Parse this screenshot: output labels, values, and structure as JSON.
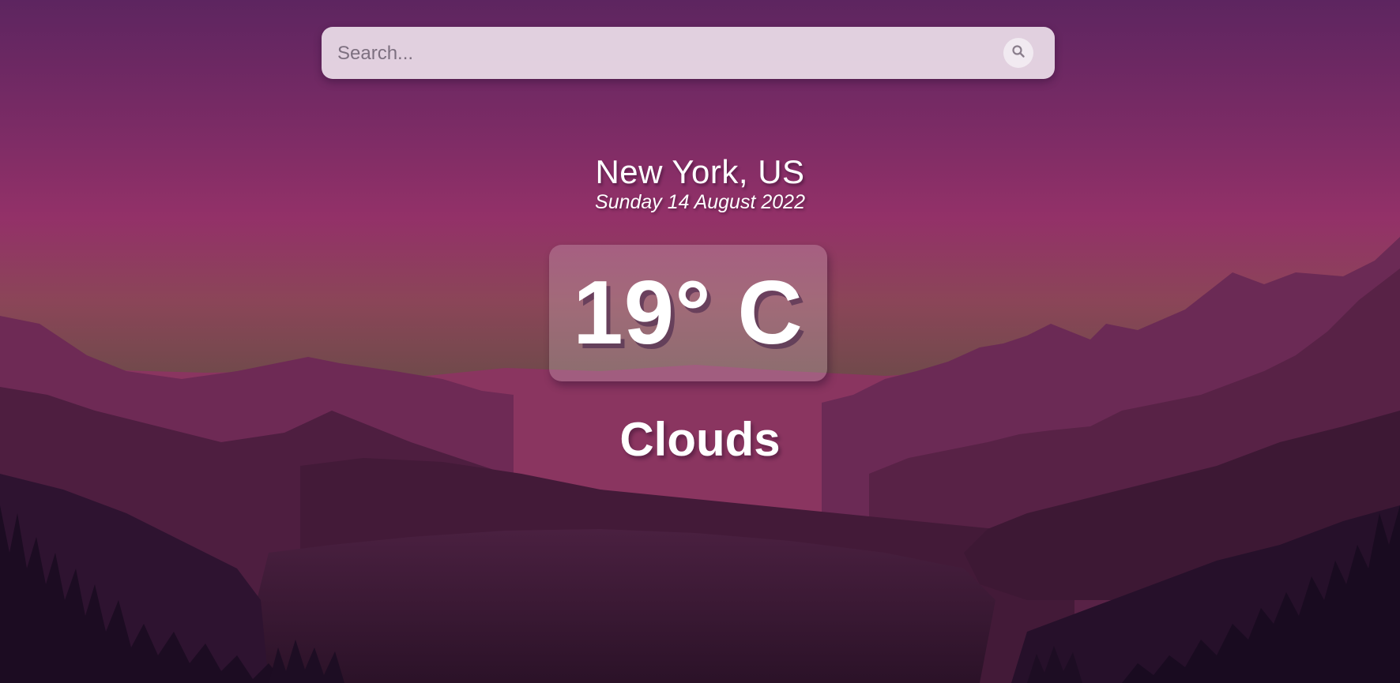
{
  "search": {
    "placeholder": "Search..."
  },
  "weather": {
    "location": "New York, US",
    "date": "Sunday 14 August 2022",
    "temperature": "19° C",
    "condition": "Clouds"
  },
  "icons": {
    "search": "search-icon"
  },
  "colors": {
    "sky_top": "#5c2560",
    "sky_mid": "#933168",
    "horizon": "#7a5a52",
    "mountain_far": "#74304f",
    "mountain_dark": "#2a1428"
  }
}
